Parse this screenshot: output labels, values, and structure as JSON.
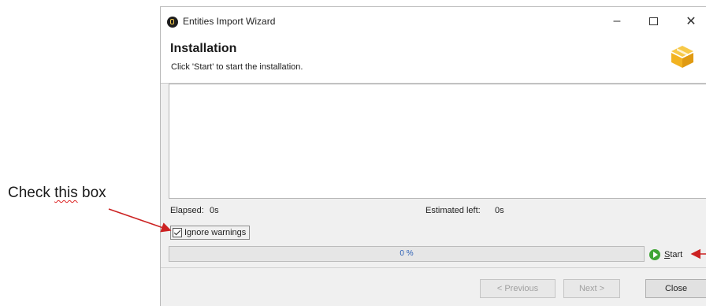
{
  "annotation": {
    "label_before": "Check ",
    "label_underlined": "this",
    "label_after": " box",
    "arrow_color": "#cc2222"
  },
  "window": {
    "title": "Entities Import Wizard",
    "controls": {
      "minimize": "–",
      "close": "✕"
    }
  },
  "header": {
    "title": "Installation",
    "subtitle": "Click 'Start' to start the installation.",
    "icon": "package-box-icon",
    "icon_color": "#f2b321"
  },
  "stats": {
    "elapsed_label": "Elapsed:",
    "elapsed_value": "0s",
    "estimated_label": "Estimated left:",
    "estimated_value": "0s"
  },
  "options": {
    "ignore_warnings_label": "Ignore warnings",
    "ignore_warnings_checked": true
  },
  "progress": {
    "percent": 0,
    "text": "0 %"
  },
  "start_button": {
    "label": "Start",
    "icon": "play-icon",
    "icon_color": "#3fa535"
  },
  "footer": {
    "previous_label": "< Previous",
    "next_label": "Next >",
    "close_label": "Close"
  }
}
